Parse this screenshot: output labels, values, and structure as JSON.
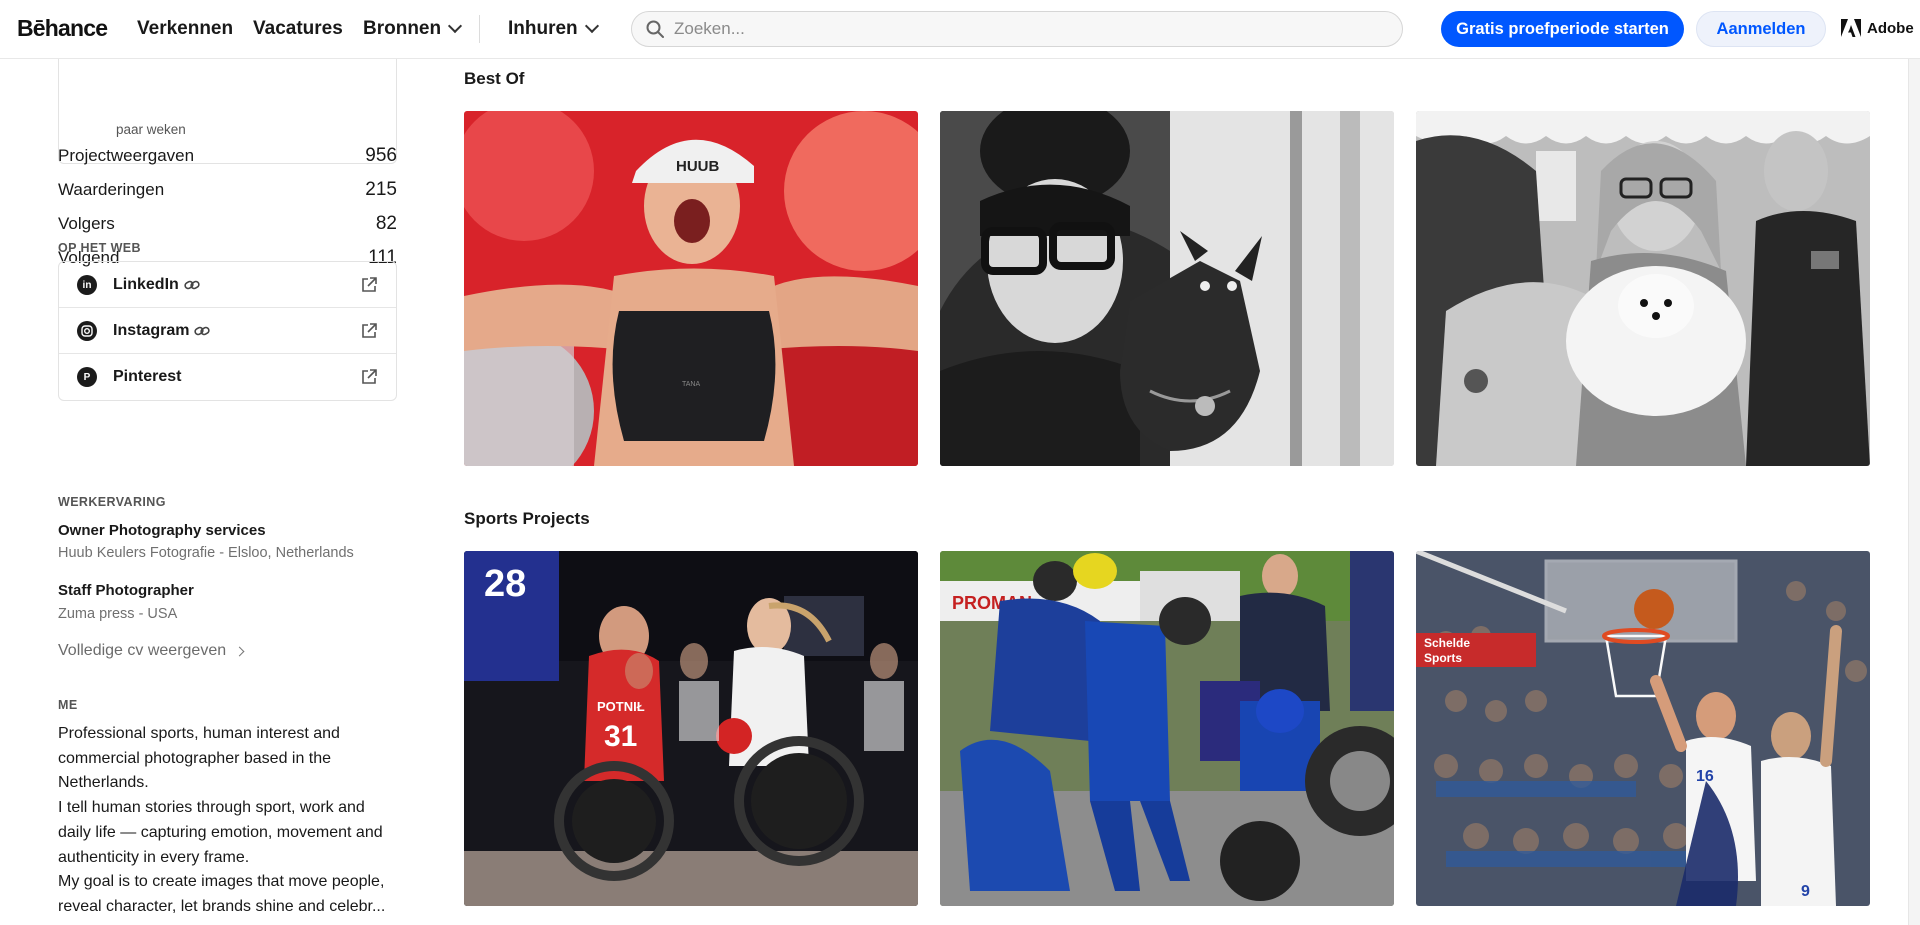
{
  "header": {
    "logo": "Bēhance",
    "nav": [
      "Verkennen",
      "Vacatures",
      "Bronnen",
      "Inhuren"
    ],
    "search_placeholder": "Zoeken...",
    "trial_button": "Gratis proefperiode starten",
    "login_button": "Aanmelden",
    "adobe_label": "Adobe"
  },
  "sidebar": {
    "top_note": "paar weken",
    "stats": [
      {
        "label": "Projectweergaven",
        "value": "956"
      },
      {
        "label": "Waarderingen",
        "value": "215"
      },
      {
        "label": "Volgers",
        "value": "82"
      },
      {
        "label": "Volgend",
        "value": "111"
      }
    ],
    "web_heading": "OP HET WEB",
    "web_links": [
      {
        "name": "LinkedIn",
        "icon": "linkedin-icon"
      },
      {
        "name": "Instagram",
        "icon": "instagram-icon"
      },
      {
        "name": "Pinterest",
        "icon": "pinterest-icon"
      }
    ],
    "experience_heading": "WERKERVARING",
    "jobs": [
      {
        "title": "Owner Photography services",
        "company": "Huub Keulers Fotografie - Elsloo, Netherlands"
      },
      {
        "title": "Staff Photographer",
        "company": "Zuma press - USA"
      }
    ],
    "cv_link": "Volledige cv weergeven",
    "about_heading": "ME",
    "about": [
      "Professional sports, human interest and commercial photographer based in the Netherlands.",
      "I tell human stories through sport, work and daily life — capturing emotion, movement and authenticity in every frame.",
      "My goal is to create images that move people, reveal character, let brands shine and celebr..."
    ]
  },
  "main": {
    "sections": [
      {
        "title": "Best Of",
        "projects": [
          "project-runner",
          "project-dog-lady",
          "project-dog-market"
        ]
      },
      {
        "title": "Sports Projects",
        "projects": [
          "project-wheelchair-rugby",
          "project-moto-pitstop",
          "project-basketball"
        ]
      }
    ]
  },
  "image_text": {
    "cap_brand": "HUUB",
    "shirt_brand": "TANA",
    "bib_number": "28",
    "jersey_name": "POTNIŁ",
    "jersey_number": "31",
    "banner": "PROMAN",
    "sponsor_line1": "Schelde",
    "sponsor_line2": "Sports"
  }
}
